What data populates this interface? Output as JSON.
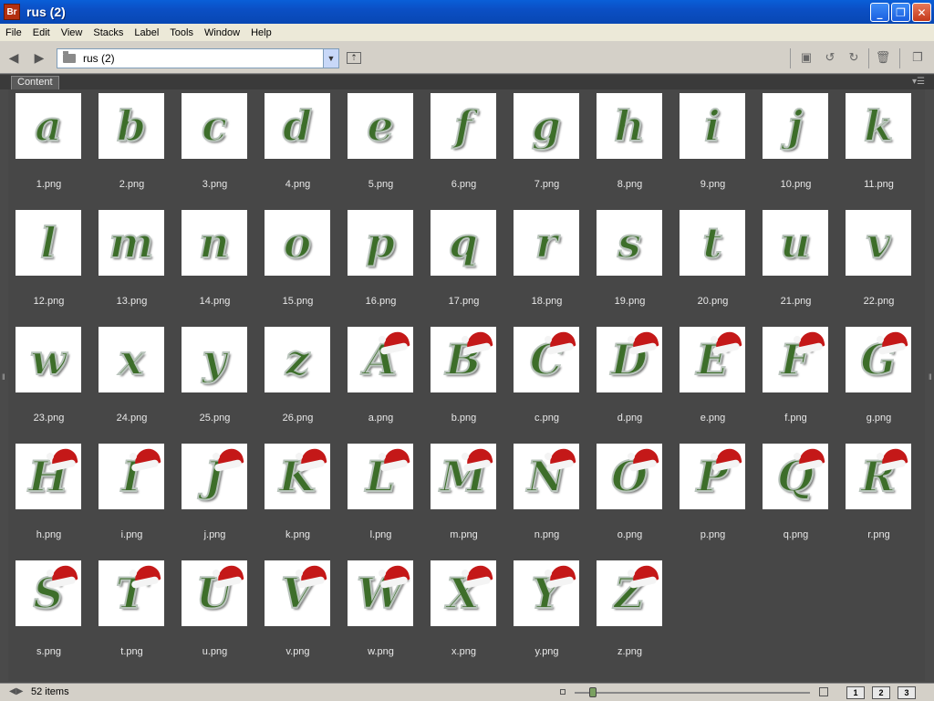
{
  "window": {
    "title": "rus (2)",
    "app_icon_label": "Br"
  },
  "menu": [
    "File",
    "Edit",
    "View",
    "Stacks",
    "Label",
    "Tools",
    "Window",
    "Help"
  ],
  "path": {
    "current_folder": "rus (2)"
  },
  "panel": {
    "tab_label": "Content"
  },
  "items": [
    {
      "glyph": "a",
      "name": "1.png",
      "hat": false
    },
    {
      "glyph": "b",
      "name": "2.png",
      "hat": false
    },
    {
      "glyph": "c",
      "name": "3.png",
      "hat": false
    },
    {
      "glyph": "d",
      "name": "4.png",
      "hat": false
    },
    {
      "glyph": "e",
      "name": "5.png",
      "hat": false
    },
    {
      "glyph": "f",
      "name": "6.png",
      "hat": false
    },
    {
      "glyph": "g",
      "name": "7.png",
      "hat": false
    },
    {
      "glyph": "h",
      "name": "8.png",
      "hat": false
    },
    {
      "glyph": "i",
      "name": "9.png",
      "hat": false
    },
    {
      "glyph": "j",
      "name": "10.png",
      "hat": false
    },
    {
      "glyph": "k",
      "name": "11.png",
      "hat": false
    },
    {
      "glyph": "l",
      "name": "12.png",
      "hat": false
    },
    {
      "glyph": "m",
      "name": "13.png",
      "hat": false
    },
    {
      "glyph": "n",
      "name": "14.png",
      "hat": false
    },
    {
      "glyph": "o",
      "name": "15.png",
      "hat": false
    },
    {
      "glyph": "p",
      "name": "16.png",
      "hat": false
    },
    {
      "glyph": "q",
      "name": "17.png",
      "hat": false
    },
    {
      "glyph": "r",
      "name": "18.png",
      "hat": false
    },
    {
      "glyph": "s",
      "name": "19.png",
      "hat": false
    },
    {
      "glyph": "t",
      "name": "20.png",
      "hat": false
    },
    {
      "glyph": "u",
      "name": "21.png",
      "hat": false
    },
    {
      "glyph": "v",
      "name": "22.png",
      "hat": false
    },
    {
      "glyph": "w",
      "name": "23.png",
      "hat": false
    },
    {
      "glyph": "x",
      "name": "24.png",
      "hat": false
    },
    {
      "glyph": "y",
      "name": "25.png",
      "hat": false
    },
    {
      "glyph": "z",
      "name": "26.png",
      "hat": false
    },
    {
      "glyph": "A",
      "name": "a.png",
      "hat": true
    },
    {
      "glyph": "B",
      "name": "b.png",
      "hat": true
    },
    {
      "glyph": "C",
      "name": "c.png",
      "hat": true
    },
    {
      "glyph": "D",
      "name": "d.png",
      "hat": true
    },
    {
      "glyph": "E",
      "name": "e.png",
      "hat": true
    },
    {
      "glyph": "F",
      "name": "f.png",
      "hat": true
    },
    {
      "glyph": "G",
      "name": "g.png",
      "hat": true
    },
    {
      "glyph": "H",
      "name": "h.png",
      "hat": true
    },
    {
      "glyph": "I",
      "name": "i.png",
      "hat": true
    },
    {
      "glyph": "J",
      "name": "j.png",
      "hat": true
    },
    {
      "glyph": "K",
      "name": "k.png",
      "hat": true
    },
    {
      "glyph": "L",
      "name": "l.png",
      "hat": true
    },
    {
      "glyph": "M",
      "name": "m.png",
      "hat": true
    },
    {
      "glyph": "N",
      "name": "n.png",
      "hat": true
    },
    {
      "glyph": "O",
      "name": "o.png",
      "hat": true
    },
    {
      "glyph": "P",
      "name": "p.png",
      "hat": true
    },
    {
      "glyph": "Q",
      "name": "q.png",
      "hat": true
    },
    {
      "glyph": "R",
      "name": "r.png",
      "hat": true
    },
    {
      "glyph": "S",
      "name": "s.png",
      "hat": true
    },
    {
      "glyph": "T",
      "name": "t.png",
      "hat": true
    },
    {
      "glyph": "U",
      "name": "u.png",
      "hat": true
    },
    {
      "glyph": "V",
      "name": "v.png",
      "hat": true
    },
    {
      "glyph": "W",
      "name": "w.png",
      "hat": true
    },
    {
      "glyph": "X",
      "name": "x.png",
      "hat": true
    },
    {
      "glyph": "Y",
      "name": "y.png",
      "hat": true
    },
    {
      "glyph": "Z",
      "name": "z.png",
      "hat": true
    }
  ],
  "status": {
    "item_count": "52 items"
  },
  "view_buttons": [
    "1",
    "2",
    "3"
  ],
  "colors": {
    "titlebar": "#0b4fc4",
    "content_bg": "#474747",
    "glyph": "#3d6e2a",
    "hat": "#c41818"
  }
}
